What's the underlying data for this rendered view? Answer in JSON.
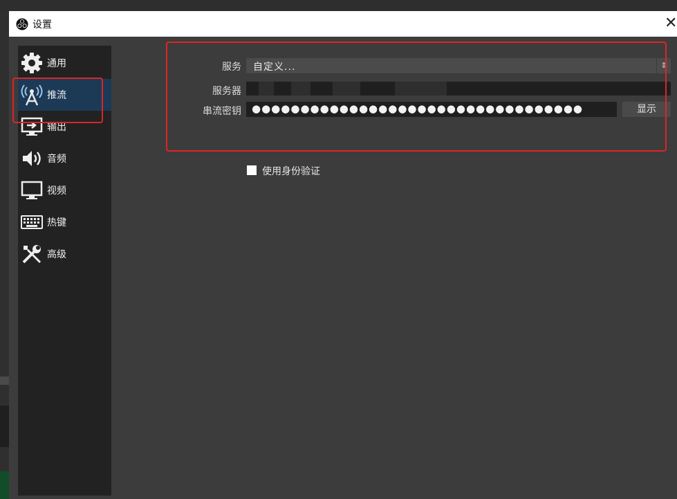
{
  "window": {
    "title": "设置"
  },
  "sidebar": {
    "items": [
      {
        "label": "通用",
        "icon": "gear-icon"
      },
      {
        "label": "推流",
        "icon": "broadcast-tower-icon",
        "active": true
      },
      {
        "label": "输出",
        "icon": "output-monitor-icon"
      },
      {
        "label": "音频",
        "icon": "speaker-icon"
      },
      {
        "label": "视频",
        "icon": "monitor-icon"
      },
      {
        "label": "热键",
        "icon": "keyboard-icon"
      },
      {
        "label": "高级",
        "icon": "tools-icon"
      }
    ]
  },
  "stream": {
    "service_label": "服务",
    "service_value": "自定义...",
    "server_label": "服务器",
    "key_label": "串流密钥",
    "key_dots": "●●●●●●●●●●●●●●●●●●●●●●●●●●●●●●●●●●",
    "show_button": "显示",
    "auth_label": "使用身份验证",
    "auth_checked": false
  },
  "colors": {
    "sidebar_active": "#1c3a56",
    "annotation_red": "#e02424"
  }
}
